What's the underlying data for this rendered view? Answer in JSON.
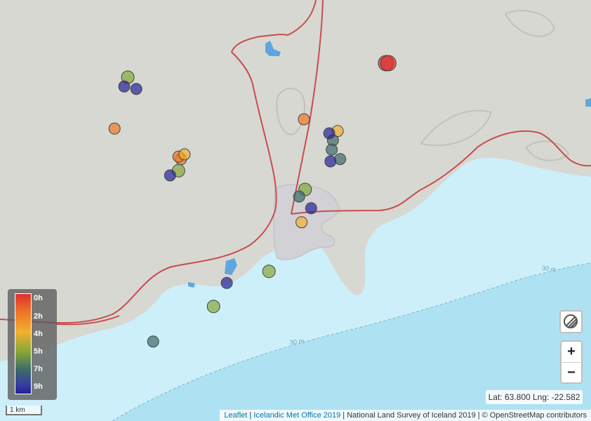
{
  "legend": {
    "labels": [
      "0h",
      "2h",
      "4h",
      "5h",
      "7h",
      "9h"
    ]
  },
  "coordinates": "Lat: 63.800 Lng: -22.582",
  "scale": "1 km",
  "zoom": {
    "in": "+",
    "out": "−"
  },
  "depth_labels": [
    "30 m",
    "30 m"
  ],
  "attribution": {
    "leaflet": "Leaflet",
    "sep1": " | ",
    "imo": "Icelandic Met Office 2019",
    "rest": " | National Land Survey of Iceland 2019 | © OpenStreetMap contributors"
  },
  "colors": {
    "0h": "#e03030",
    "2h": "#f07a26",
    "4h": "#f3b02e",
    "5h": "#86a838",
    "7h": "#3c6b6a",
    "9h": "#23229a",
    "sea": "#cdeff9",
    "land": "#d8d8d2",
    "road": "#c84d4d",
    "town": "#d0d0d4"
  },
  "markers": [
    {
      "age": "0h",
      "lat": 63.853,
      "lng": -22.43
    },
    {
      "age": "0h",
      "lat": 63.853,
      "lng": -22.428
    },
    {
      "age": "2h",
      "lat": 63.825,
      "lng": -22.655
    },
    {
      "age": "2h",
      "lat": 63.829,
      "lng": -22.498
    },
    {
      "age": "2h",
      "lat": 63.812,
      "lng": -22.6
    },
    {
      "age": "2h",
      "lat": 63.813,
      "lng": -22.602
    },
    {
      "age": "4h",
      "lat": 63.814,
      "lng": -22.597
    },
    {
      "age": "4h",
      "lat": 63.824,
      "lng": -22.47
    },
    {
      "age": "4h",
      "lat": 63.785,
      "lng": -22.5
    },
    {
      "age": "5h",
      "lat": 63.847,
      "lng": -22.644
    },
    {
      "age": "5h",
      "lat": 63.807,
      "lng": -22.602
    },
    {
      "age": "5h",
      "lat": 63.799,
      "lng": -22.497
    },
    {
      "age": "5h",
      "lat": 63.764,
      "lng": -22.527
    },
    {
      "age": "5h",
      "lat": 63.749,
      "lng": -22.573
    },
    {
      "age": "7h",
      "lat": 63.82,
      "lng": -22.474
    },
    {
      "age": "7h",
      "lat": 63.816,
      "lng": -22.475
    },
    {
      "age": "7h",
      "lat": 63.812,
      "lng": -22.468
    },
    {
      "age": "7h",
      "lat": 63.796,
      "lng": -22.502
    },
    {
      "age": "7h",
      "lat": 63.734,
      "lng": -22.623
    },
    {
      "age": "9h",
      "lat": 63.843,
      "lng": -22.647
    },
    {
      "age": "9h",
      "lat": 63.842,
      "lng": -22.637
    },
    {
      "age": "9h",
      "lat": 63.805,
      "lng": -22.609
    },
    {
      "age": "9h",
      "lat": 63.811,
      "lng": -22.476
    },
    {
      "age": "9h",
      "lat": 63.823,
      "lng": -22.477
    },
    {
      "age": "9h",
      "lat": 63.791,
      "lng": -22.492
    },
    {
      "age": "9h",
      "lat": 63.759,
      "lng": -22.562
    }
  ]
}
